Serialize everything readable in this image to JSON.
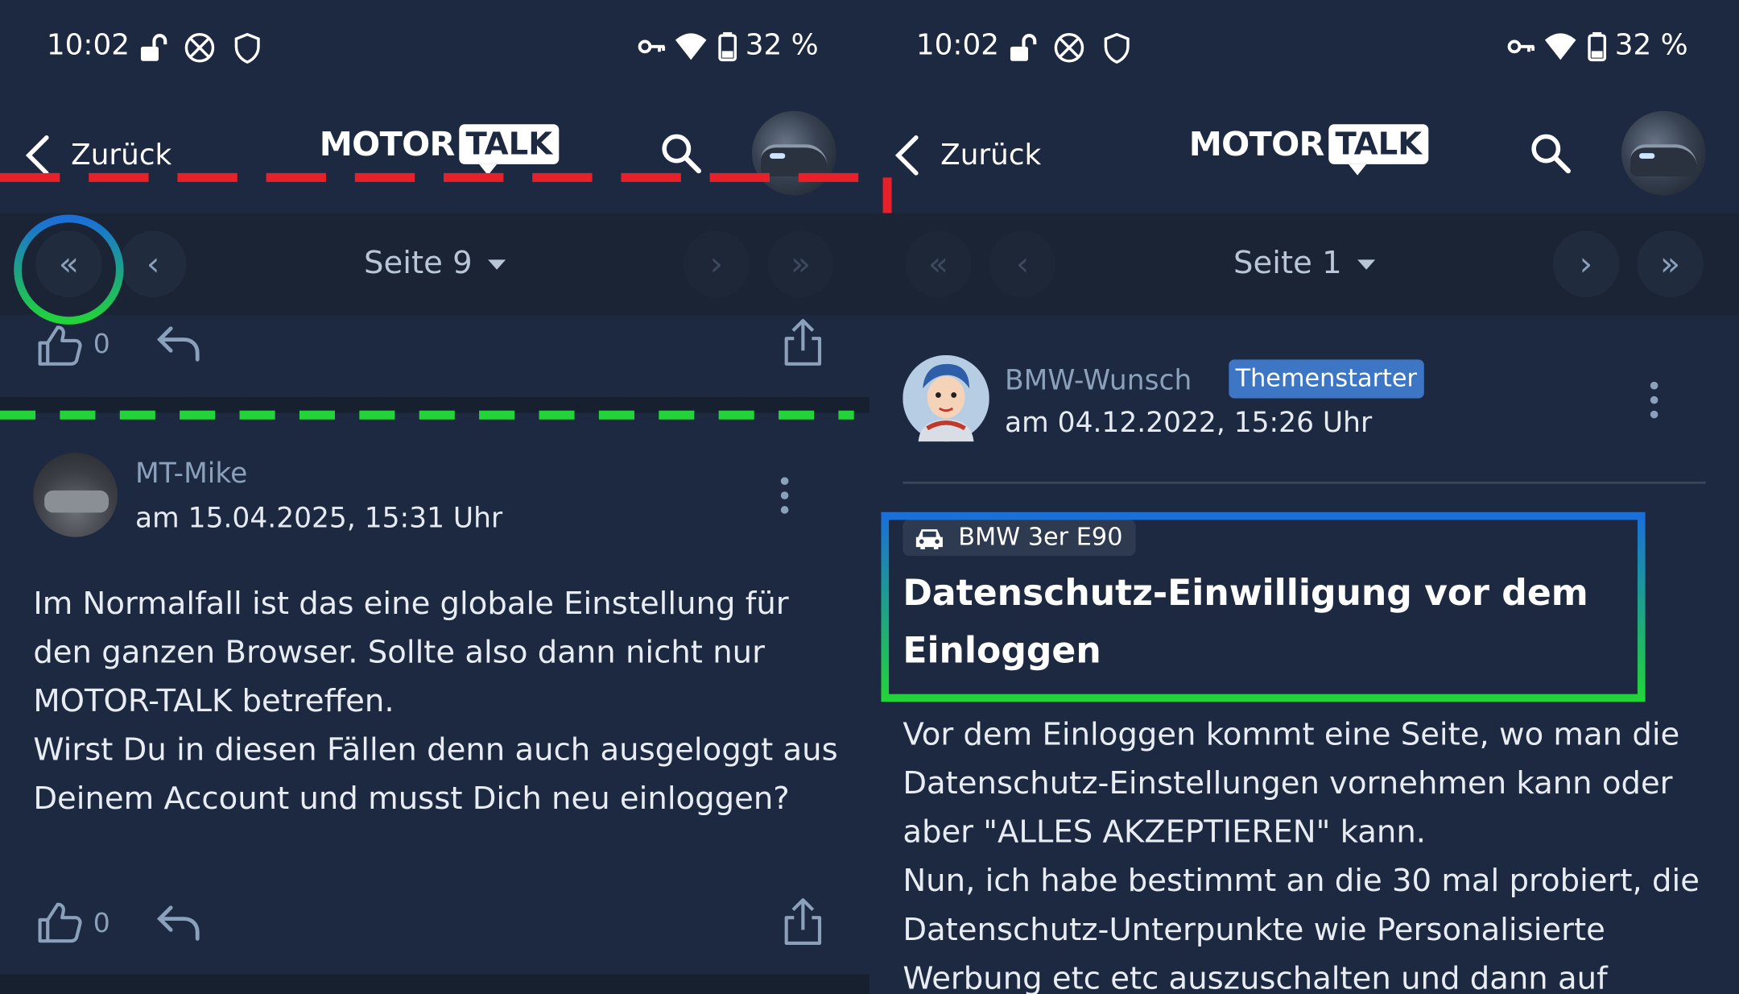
{
  "status_bar": {
    "time": "10:02",
    "battery": "32 %"
  },
  "nav": {
    "back_label": "Zurück",
    "logo_left": "MOTOR",
    "logo_right": "TALK"
  },
  "left_panel": {
    "pager": {
      "page_label": "Seite 9"
    },
    "prev_post": {
      "like_count": "0"
    },
    "post": {
      "author": "MT-Mike",
      "date": "am 15.04.2025, 15:31 Uhr",
      "paragraphs": [
        "Im Normalfall ist das eine globale Einstellung für den ganzen Browser. Sollte also dann nicht nur MOTOR-TALK betreffen.",
        "Wirst Du in diesen Fällen denn auch ausgeloggt aus Deinem Account und musst Dich neu einloggen?"
      ],
      "like_count": "0"
    }
  },
  "right_panel": {
    "pager": {
      "page_label": "Seite 1"
    },
    "post": {
      "author": "BMW-Wunsch",
      "badge": "Themenstarter",
      "date": "am 04.12.2022, 15:26 Uhr",
      "vehicle_tag": "BMW 3er E90",
      "title": "Datenschutz-Einwilligung vor dem Einloggen",
      "paragraphs": [
        "Vor dem Einloggen kommt eine Seite, wo man die Datenschutz-Einstellungen vornehmen kann oder aber \"ALLES AKZEPTIEREN\" kann.",
        "Nun, ich habe bestimmt an die 30 mal probiert, die Datenschutz-Unterpunkte wie Personalisierte Werbung etc etc auszuschalten und dann auf"
      ]
    }
  },
  "colors": {
    "background": "#1c2940",
    "pager_bg": "#1a2434",
    "accent_blue": "#3d76c4",
    "muted_text": "#8aa0bb",
    "annotation_red": "#e8202a",
    "annotation_green": "#22d33a",
    "annotation_blue": "#1a6fd8"
  },
  "icons": [
    "lock-open-icon",
    "no-sim-icon",
    "shield-icon",
    "key-icon",
    "wifi-icon",
    "battery-icon",
    "chevron-left-icon",
    "search-icon",
    "first-page-icon",
    "prev-page-icon",
    "next-page-icon",
    "last-page-icon",
    "thumbs-up-icon",
    "reply-icon",
    "share-icon",
    "more-vert-icon",
    "car-icon"
  ]
}
